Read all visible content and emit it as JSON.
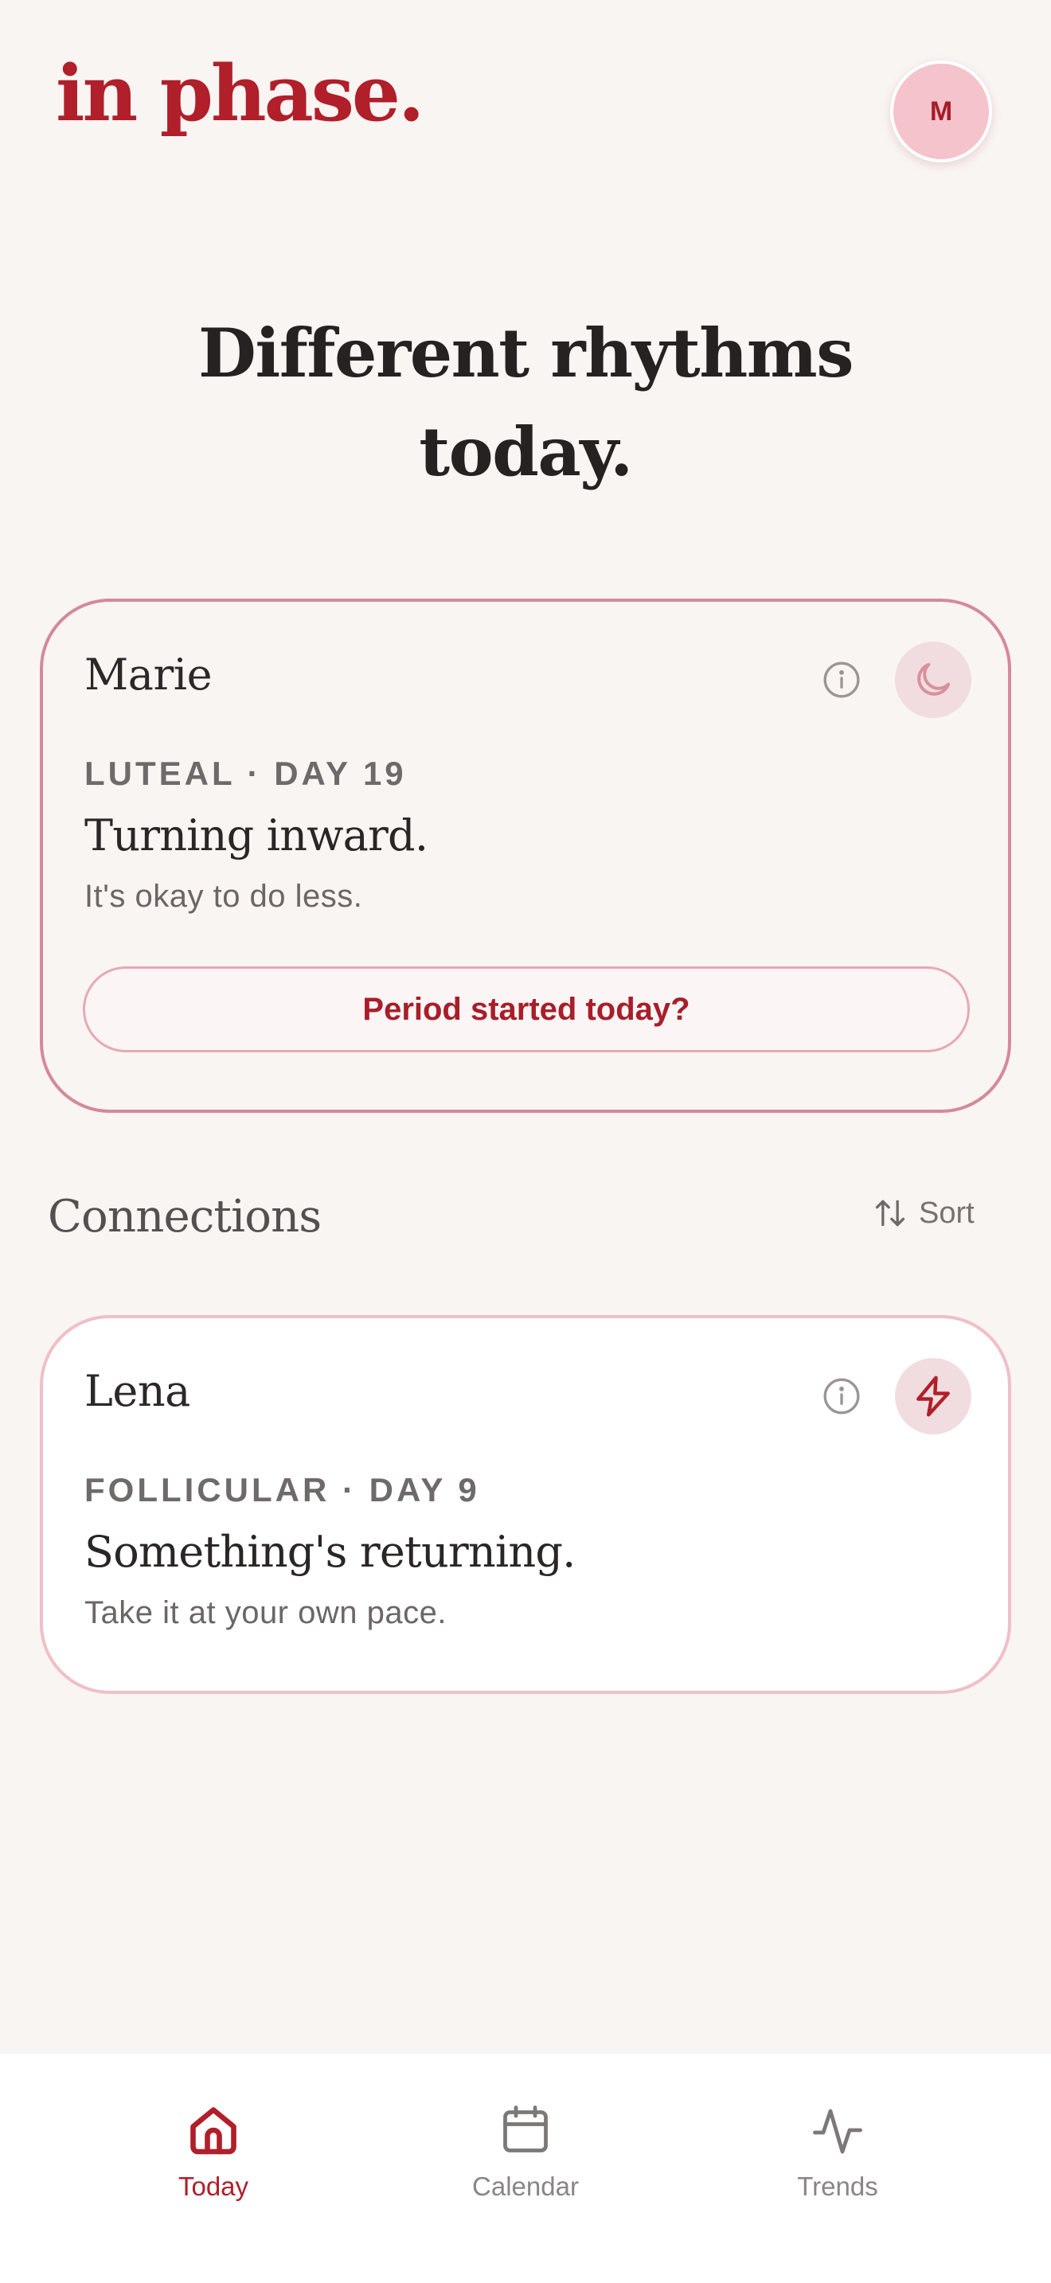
{
  "app": {
    "logo": "in phase.",
    "avatar_initial": "M"
  },
  "headline": {
    "line1": "Different rhythms",
    "line2": "today."
  },
  "self_card": {
    "name": "Marie",
    "phase_label": "LUTEAL · DAY 19",
    "title": "Turning inward.",
    "subtitle": "It's okay to do less.",
    "period_button": "Period started today?",
    "phase_icon": "moon-icon"
  },
  "connections": {
    "section_title": "Connections",
    "sort_label": "Sort",
    "items": [
      {
        "name": "Lena",
        "phase_label": "FOLLICULAR · DAY 9",
        "title": "Something's returning.",
        "subtitle": "Take it at your own pace.",
        "phase_icon": "lightning-icon"
      }
    ]
  },
  "nav": {
    "items": [
      {
        "label": "Today",
        "icon": "home-icon",
        "active": true
      },
      {
        "label": "Calendar",
        "icon": "calendar-icon",
        "active": false
      },
      {
        "label": "Trends",
        "icon": "activity-icon",
        "active": false
      }
    ]
  },
  "colors": {
    "accent": "#b01f2a",
    "background": "#f9f5f3",
    "card_border_self": "#d48a98",
    "card_border_connection": "#f0bfc8",
    "icon_circle": "#f1dde0"
  }
}
